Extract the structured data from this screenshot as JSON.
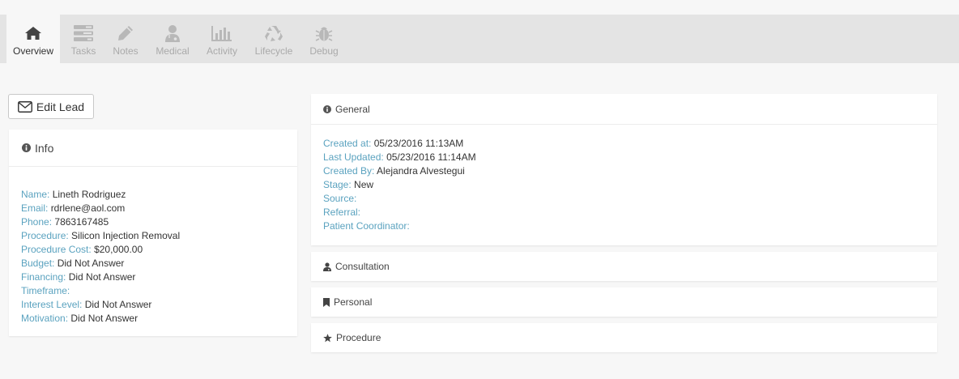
{
  "tabs": [
    {
      "label": "Overview",
      "icon": "home-icon",
      "active": true
    },
    {
      "label": "Tasks",
      "icon": "tasks-icon",
      "active": false
    },
    {
      "label": "Notes",
      "icon": "pencil-icon",
      "active": false
    },
    {
      "label": "Medical",
      "icon": "doctor-icon",
      "active": false
    },
    {
      "label": "Activity",
      "icon": "bar-chart-icon",
      "active": false
    },
    {
      "label": "Lifecycle",
      "icon": "recycle-icon",
      "active": false
    },
    {
      "label": "Debug",
      "icon": "bug-icon",
      "active": false
    }
  ],
  "edit_button": {
    "label": "Edit Lead",
    "icon": "envelope-icon"
  },
  "info": {
    "title": "Info",
    "fields": [
      {
        "key": "Name:",
        "value": "Lineth Rodriguez"
      },
      {
        "key": "Email:",
        "value": "rdrlene@aol.com"
      },
      {
        "key": "Phone:",
        "value": "7863167485"
      },
      {
        "key": "Procedure:",
        "value": "Silicon Injection Removal"
      },
      {
        "key": "Procedure Cost:",
        "value": "$20,000.00"
      },
      {
        "key": "Budget:",
        "value": "Did Not Answer"
      },
      {
        "key": "Financing:",
        "value": "Did Not Answer"
      },
      {
        "key": "Timeframe:",
        "value": ""
      },
      {
        "key": "Interest Level:",
        "value": "Did Not Answer"
      },
      {
        "key": "Motivation:",
        "value": "Did Not Answer"
      }
    ]
  },
  "general": {
    "title": "General",
    "fields": [
      {
        "key": "Created at:",
        "value": "05/23/2016 11:13AM"
      },
      {
        "key": "Last Updated:",
        "value": "05/23/2016 11:14AM"
      },
      {
        "key": "Created By:",
        "value": "Alejandra Alvestegui"
      },
      {
        "key": "Stage:",
        "value": "New"
      },
      {
        "key": "Source:",
        "value": ""
      },
      {
        "key": "Referral:",
        "value": ""
      },
      {
        "key": "Patient Coordinator:",
        "value": ""
      }
    ]
  },
  "sections": {
    "consultation": "Consultation",
    "personal": "Personal",
    "procedure": "Procedure"
  },
  "colors": {
    "label": "#5aa2bf",
    "text": "#333333",
    "tab_inactive": "#aaaaaa"
  }
}
